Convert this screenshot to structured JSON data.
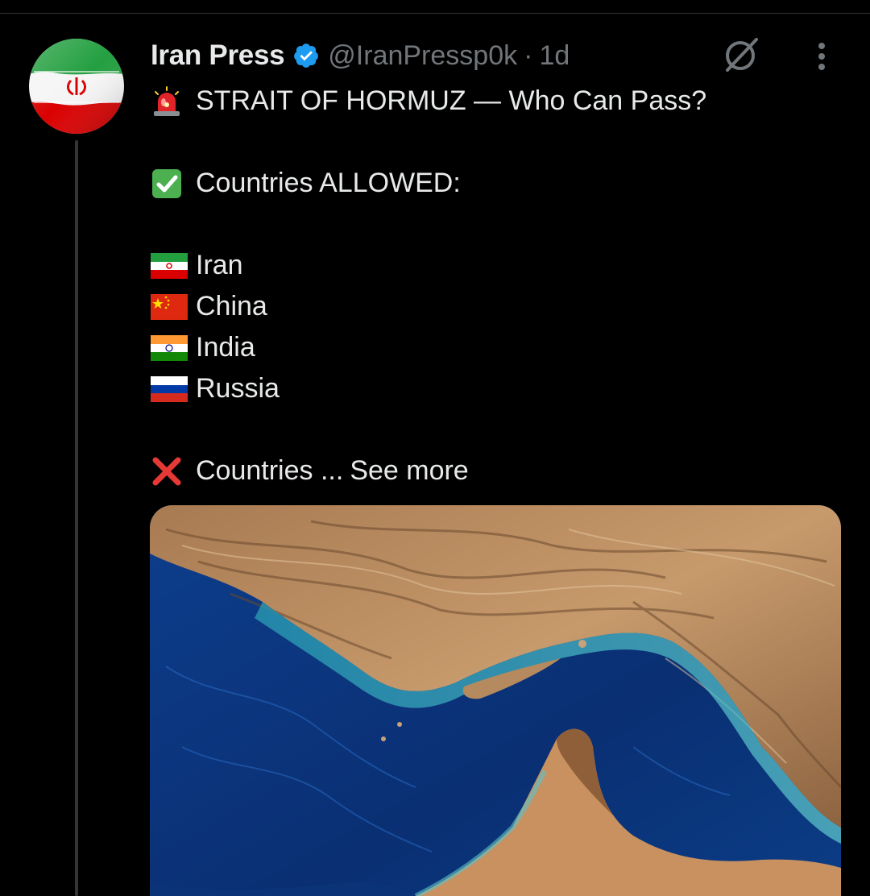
{
  "tweet": {
    "display_name": "Iran Press",
    "handle": "@IranPressp0k",
    "separator": "·",
    "time": "1d",
    "verified_color": "#1d9bf0",
    "headline": "STRAIT OF HORMUZ — Who Can Pass?",
    "allowed_heading": "Countries ALLOWED:",
    "allowed": [
      "Iran",
      "China",
      "India",
      "Russia"
    ],
    "blocked_heading": "Countries ...",
    "see_more": "See more",
    "icons": {
      "headline": "police-siren-emoji",
      "allowed": "check-mark-button-emoji",
      "blocked": "cross-mark-emoji",
      "flags": [
        "iran-flag-emoji",
        "china-flag-emoji",
        "india-flag-emoji",
        "russia-flag-emoji"
      ]
    }
  },
  "colors": {
    "background": "#000000",
    "text": "#e7e9ea",
    "secondary_text": "#71767b",
    "divider": "#2f3336"
  }
}
